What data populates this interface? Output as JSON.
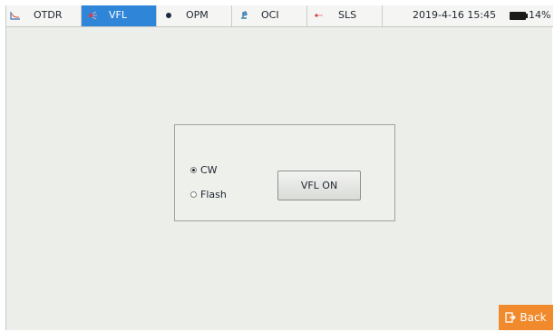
{
  "tabs": [
    {
      "label": "OTDR",
      "icon": "otdr-trace-icon",
      "active": false
    },
    {
      "label": "VFL",
      "icon": "laser-red-icon",
      "active": true
    },
    {
      "label": "OPM",
      "icon": "power-meter-dot-icon",
      "active": false
    },
    {
      "label": "OCI",
      "icon": "microscope-icon",
      "active": false
    },
    {
      "label": "SLS",
      "icon": "light-source-icon",
      "active": false
    }
  ],
  "status": {
    "datetime": "2019-4-16 15:45",
    "battery_percent": "14%",
    "battery_level": 0.14
  },
  "panel": {
    "mode_options": [
      {
        "label": "CW",
        "selected": true
      },
      {
        "label": "Flash",
        "selected": false
      }
    ],
    "vfl_button_label": "VFL ON"
  },
  "back_button": {
    "label": "Back",
    "icon": "exit-icon"
  },
  "colors": {
    "active_tab": "#2f86d8",
    "back_button": "#f18a2c",
    "background": "#eceeea"
  }
}
